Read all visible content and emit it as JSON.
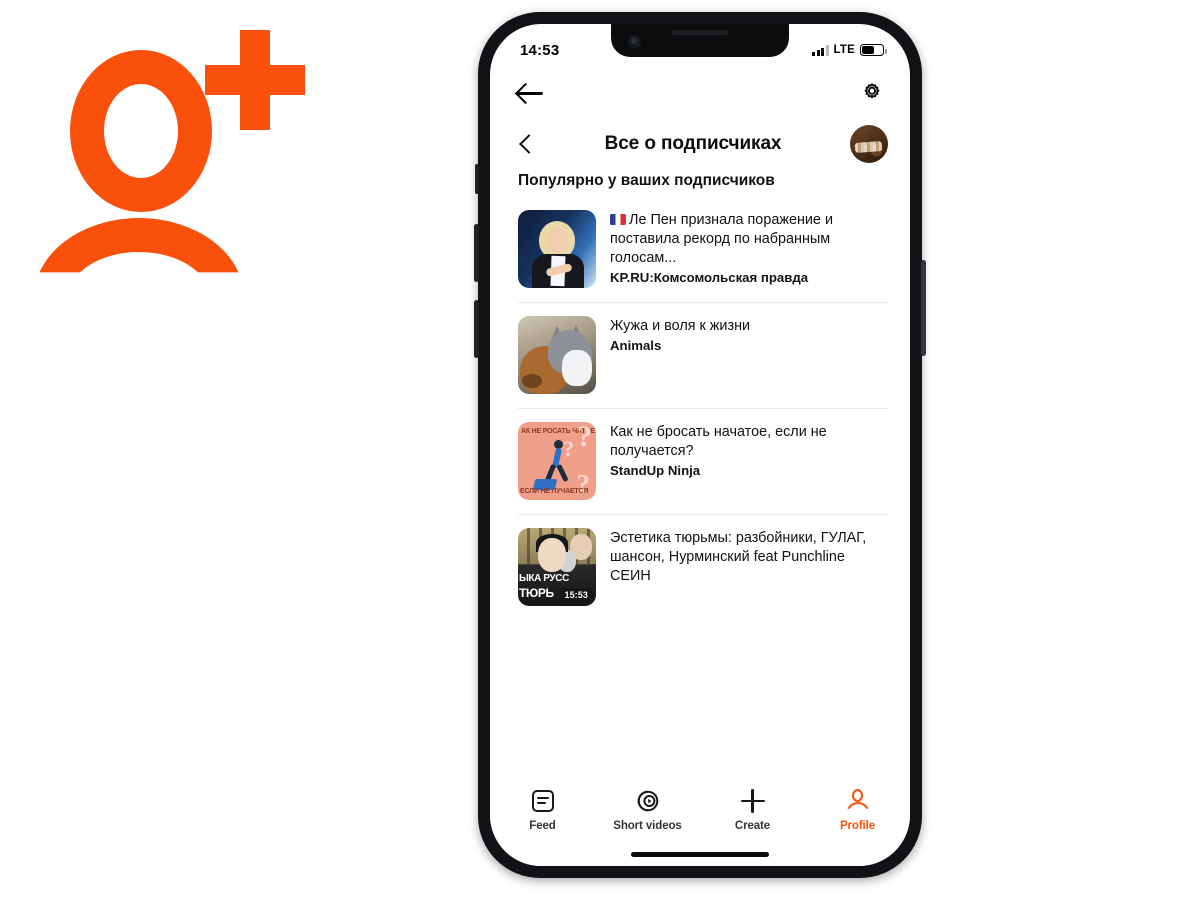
{
  "brand": {
    "name": "ok-plus-logo",
    "color": "#F9500B",
    "alt": "OK+"
  },
  "phone": {
    "status_bar": {
      "time": "14:53",
      "network": "LTE",
      "signal_bars": 4,
      "battery_level": 55
    },
    "app_bar": {
      "back_icon": "arrow-left-icon",
      "settings_icon": "gear-icon"
    },
    "title_bar": {
      "back_chevron": "chevron-left-icon",
      "title": "Все о подписчиках",
      "avatar": "user-avatar"
    },
    "section": {
      "header": "Популярно у ваших подписчиков"
    },
    "feed": [
      {
        "title": "Ле Пен признала поражение и поставила рекорд по набранным голосам...",
        "source": "KP.RU:Комсомольская правда",
        "has_flag": true,
        "flag": "french-flag",
        "thumb": "le-pen-photo",
        "duration": ""
      },
      {
        "title": "Жужа и воля к жизни",
        "source": "Animals",
        "has_flag": false,
        "flag": "",
        "thumb": "cat-and-dog-photo",
        "duration": ""
      },
      {
        "title": "Как не бросать начатое, если не получается?",
        "source": "StandUp Ninja",
        "has_flag": false,
        "flag": "",
        "thumb": "question-marks-illustration",
        "duration": "",
        "thumb_text_top": "АК НЕ РОСАТЬ ЧАТОЕ",
        "thumb_text_bottom": "ЕСЛИ НЕ ЛУЧАЕТСЯ"
      },
      {
        "title": "Эстетика тюрьмы: разбойники, ГУЛАГ, шансон, Нурминский feat Punchline СЕИН",
        "source": "",
        "has_flag": false,
        "flag": "",
        "thumb": "prison-video-thumbnail",
        "duration": "15:53",
        "thumb_text_top": "ЫКА РУСС",
        "thumb_text_bottom": "ТЮРЬ"
      }
    ],
    "tab_bar": {
      "active": "Profile",
      "active_color": "#F9500B",
      "items": [
        {
          "label": "Feed",
          "icon": "feed-icon"
        },
        {
          "label": "Short videos",
          "icon": "short-videos-icon"
        },
        {
          "label": "Create",
          "icon": "plus-icon"
        },
        {
          "label": "Profile",
          "icon": "profile-person-icon"
        }
      ]
    }
  }
}
